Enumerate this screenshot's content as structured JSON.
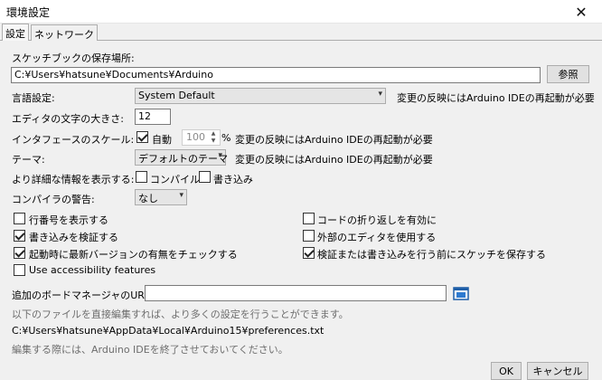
{
  "window": {
    "title": "環境設定"
  },
  "tabs": [
    {
      "label": "設定"
    },
    {
      "label": "ネットワーク"
    }
  ],
  "sketchbook": {
    "label": "スケッチブックの保存場所:",
    "path": "C:¥Users¥hatsune¥Documents¥Arduino",
    "browse_label": "参照"
  },
  "language": {
    "label": "言語設定:",
    "value": "System Default",
    "note": "変更の反映にはArduino IDEの再起動が必要"
  },
  "font_size": {
    "label": "エディタの文字の大きさ:",
    "value": "12"
  },
  "interface_scale": {
    "label": "インタフェースのスケール:",
    "auto_label": "自動",
    "auto_checked": true,
    "value": "100",
    "unit": "%",
    "note": "変更の反映にはArduino IDEの再起動が必要"
  },
  "theme": {
    "label": "テーマ:",
    "value": "デフォルトのテーマ",
    "note": "変更の反映にはArduino IDEの再起動が必要"
  },
  "verbose": {
    "label": "より詳細な情報を表示する:",
    "compile_label": "コンパイル",
    "compile_checked": false,
    "upload_label": "書き込み",
    "upload_checked": false
  },
  "warnings": {
    "label": "コンパイラの警告:",
    "value": "なし"
  },
  "options": {
    "line_numbers": {
      "label": "行番号を表示する",
      "checked": false
    },
    "verify_upload": {
      "label": "書き込みを検証する",
      "checked": true
    },
    "check_updates": {
      "label": "起動時に最新バージョンの有無をチェックする",
      "checked": true
    },
    "accessibility": {
      "label": "Use accessibility features",
      "checked": false
    },
    "code_folding": {
      "label": "コードの折り返しを有効に",
      "checked": false
    },
    "external_editor": {
      "label": "外部のエディタを使用する",
      "checked": false
    },
    "save_before_upload": {
      "label": "検証または書き込みを行う前にスケッチを保存する",
      "checked": true
    }
  },
  "board_urls": {
    "label": "追加のボードマネージャのURL:",
    "value": ""
  },
  "footer": {
    "hint": "以下のファイルを直接編集すれば、より多くの設定を行うことができます。",
    "prefs_path": "C:¥Users¥hatsune¥AppData¥Local¥Arduino15¥preferences.txt",
    "edit_note": "編集する際には、Arduino IDEを終了させておいてください。"
  },
  "buttons": {
    "ok": "OK",
    "cancel": "キャンセル"
  },
  "icons": {
    "close": "close-icon",
    "checkbox_check": "check-icon",
    "folder_window": "window-list-icon",
    "dropdown": "chevron-down-icon"
  }
}
